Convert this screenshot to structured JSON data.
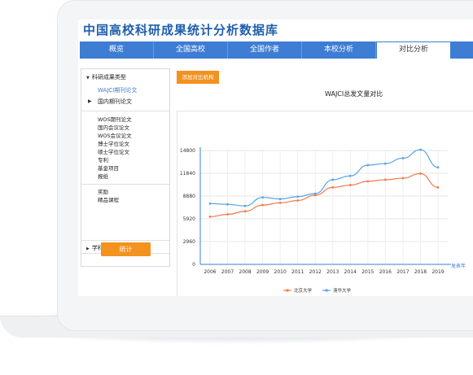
{
  "app": {
    "title": "中国高校科研成果统计分析数据库"
  },
  "nav": {
    "tabs": [
      {
        "label": "概览"
      },
      {
        "label": "全国高校"
      },
      {
        "label": "全国作者"
      },
      {
        "label": "本校分析"
      },
      {
        "label": "对比分析",
        "active": true
      }
    ]
  },
  "sidebar": {
    "group_label": "科研成果类型",
    "selected_item": "WAJCI期刊论文",
    "domestic_label": "国内期刊论文",
    "items": [
      "WOS期刊论文",
      "国内会议论文",
      "WOS会议论文",
      "博士学位论文",
      "硕士学位论文",
      "专利",
      "基金项目",
      "报纸"
    ],
    "items2": [
      "奖励",
      "精品课程"
    ],
    "subject_label": "学科",
    "stat_button": "统计"
  },
  "actions": {
    "add_compare": "添加对比机构"
  },
  "chart_data": {
    "type": "line",
    "title": "WAJCI总发文量对比",
    "x": [
      "2006",
      "2007",
      "2008",
      "2009",
      "2010",
      "2011",
      "2012",
      "2013",
      "2014",
      "2015",
      "2016",
      "2017",
      "2018",
      "2019"
    ],
    "x_unit": "发表年",
    "y_ticks": [
      0,
      2960,
      5920,
      8880,
      11840,
      14800
    ],
    "ylim": [
      0,
      14800
    ],
    "grid": true,
    "legend_position": "bottom",
    "series": [
      {
        "name": "北京大学",
        "color": "#f07b4f",
        "values": [
          6200,
          6500,
          6900,
          7700,
          8000,
          8300,
          9000,
          10000,
          10300,
          10800,
          11000,
          11200,
          11800,
          10000
        ]
      },
      {
        "name": "清华大学",
        "color": "#5aa4e6",
        "values": [
          7900,
          7800,
          7600,
          8700,
          8500,
          8800,
          9200,
          11000,
          11500,
          12900,
          13100,
          13800,
          14900,
          12600
        ]
      }
    ]
  }
}
